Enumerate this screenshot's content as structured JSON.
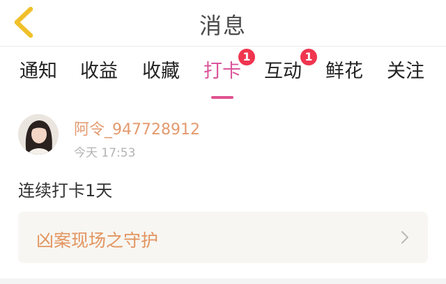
{
  "header": {
    "title": "消息",
    "back_icon": "chevron-left-icon",
    "back_icon_color": "#f0c02a"
  },
  "tabs": [
    {
      "label": "通知",
      "badge": null,
      "active": false
    },
    {
      "label": "收益",
      "badge": null,
      "active": false
    },
    {
      "label": "收藏",
      "badge": null,
      "active": false
    },
    {
      "label": "打卡",
      "badge": "1",
      "active": true
    },
    {
      "label": "互动",
      "badge": "1",
      "active": false
    },
    {
      "label": "鲜花",
      "badge": null,
      "active": false
    },
    {
      "label": "关注",
      "badge": null,
      "active": false
    }
  ],
  "message": {
    "username": "阿令_947728912",
    "time": "今天 17:53",
    "text": "连续打卡1天",
    "card_title": "凶案现场之守护",
    "card_icon": "chevron-right-icon"
  },
  "colors": {
    "accent": "#e0528f",
    "badge": "#f0354f",
    "username": "#e39a6f",
    "card_title": "#e3945f"
  }
}
